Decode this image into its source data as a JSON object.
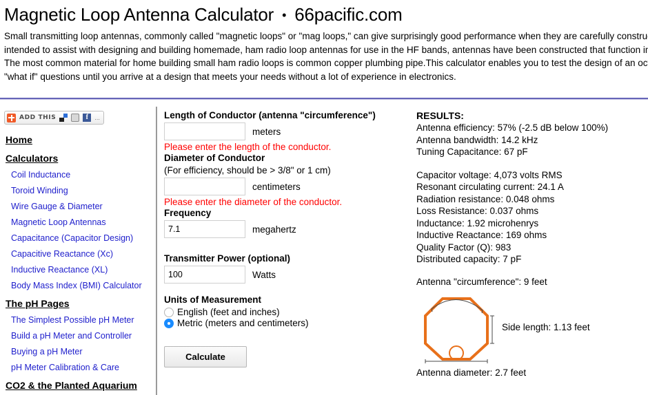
{
  "header": {
    "title_main": "Magnetic Loop Antenna Calculator",
    "title_sep": "•",
    "title_site": "66pacific.com",
    "intro": "Small transmitting loop antennas, commonly called \"magnetic loops\" or \"mag loops,\" can give surprisingly good performance when they are carefully constructed. Although this online calculator is intended to assist with designing and building homemade, ham radio loop antennas for use in the HF bands, antennas have been constructed that function in the VHF or even the UHF frequencies. The most common material for home building small ham radio loops is common copper plumbing pipe.This calculator enables you to test the design of an octagonal loop antenna and to answer \"what if\" questions until you arrive at a design that meets your needs without a lot of experience in electronics."
  },
  "sidebar": {
    "addthis": {
      "label": "ADD THIS",
      "dots": "...",
      "facebook_glyph": "f"
    },
    "home_label": "Home",
    "calculators_heading": "Calculators",
    "calculators": [
      "Coil Inductance",
      "Toroid Winding",
      "Wire Gauge & Diameter",
      "Magnetic Loop Antennas",
      "Capacitance (Capacitor Design)",
      "Capacitive Reactance (Xc)",
      "Inductive Reactance (XL)",
      "Body Mass Index (BMI) Calculator"
    ],
    "ph_heading": "The pH Pages",
    "ph_links": [
      "The Simplest Possible pH Meter",
      "Build a pH Meter and Controller",
      "Buying a pH Meter",
      "pH Meter Calibration & Care"
    ],
    "co2_heading": "CO2 & the Planted Aquarium"
  },
  "form": {
    "length_label": "Length of Conductor (antenna \"circumference\")",
    "length_value": "",
    "length_placeholder": "",
    "length_unit": "meters",
    "length_error": "Please enter the length of the conductor.",
    "diameter_label": "Diameter of Conductor",
    "diameter_sub": "(For efficiency, should be > 3/8\" or 1 cm)",
    "diameter_value": "",
    "diameter_placeholder": "",
    "diameter_unit": "centimeters",
    "diameter_error": "Please enter the diameter of the conductor.",
    "frequency_label": "Frequency",
    "frequency_value": "7.1",
    "frequency_unit": "megahertz",
    "power_label": "Transmitter Power (optional)",
    "power_value": "100",
    "power_unit": "Watts",
    "units_label": "Units of Measurement",
    "unit_english": "English (feet and inches)",
    "unit_metric": "Metric (meters and centimeters)",
    "unit_selected": "metric",
    "calculate_label": "Calculate"
  },
  "results": {
    "title": "RESULTS:",
    "group1": [
      "Antenna efficiency: 57% (-2.5 dB below 100%)",
      "Antenna bandwidth: 14.2 kHz",
      "Tuning Capacitance: 67 pF"
    ],
    "group2": [
      "Capacitor voltage: 4,073 volts RMS",
      "Resonant circulating current: 24.1 A",
      "Radiation resistance: 0.048 ohms",
      "Loss Resistance: 0.037 ohms",
      "Inductance: 1.92 microhenrys",
      "Inductive Reactance: 169 ohms",
      "Quality Factor (Q): 983",
      "Distributed capacity: 7 pF"
    ],
    "diagram": {
      "circumference_caption": "Antenna \"circumference\": 9 feet",
      "side_length_caption": "Side length: 1.13 feet",
      "diameter_caption": "Antenna diameter: 2.7 feet",
      "loop_color": "#e8701a"
    }
  },
  "colors": {
    "rule": "#6665b8",
    "link": "#2020cc",
    "error": "#ff0000",
    "radio_on": "#1a8cff",
    "addthis_orange": "#f05a28"
  }
}
